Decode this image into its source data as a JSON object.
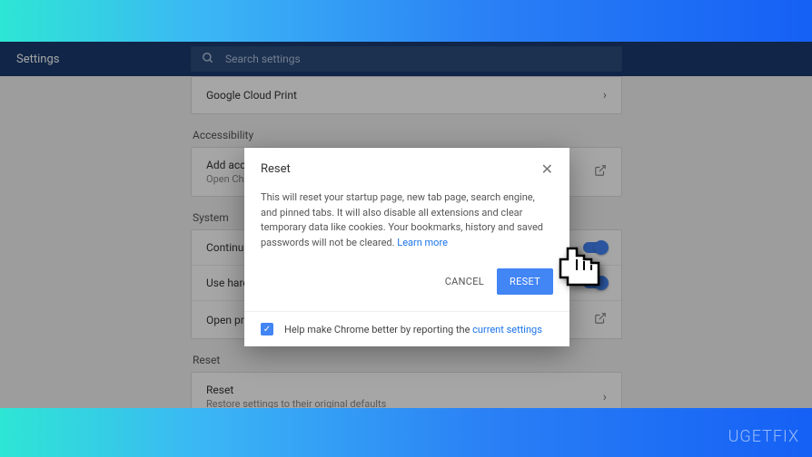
{
  "header": {
    "title": "Settings",
    "search_placeholder": "Search settings"
  },
  "sections": {
    "cloud_print": "Google Cloud Print",
    "accessibility_label": "Accessibility",
    "accessibility_title": "Add accessibility features",
    "accessibility_sub": "Open Chrome Web Store",
    "system_label": "System",
    "system_row1": "Continue running background apps when Chrome is closed",
    "system_row2": "Use hardware acceleration when available",
    "system_row3": "Open proxy settings",
    "reset_label": "Reset",
    "reset_title": "Reset",
    "reset_sub": "Restore settings to their original defaults"
  },
  "dialog": {
    "title": "Reset",
    "body_text": "This will reset your startup page, new tab page, search engine, and pinned tabs. It will also disable all extensions and clear temporary data like cookies. Your bookmarks, history and saved passwords will not be cleared. ",
    "learn_more": "Learn more",
    "cancel": "CANCEL",
    "reset": "RESET",
    "help_text": "Help make Chrome better by reporting the ",
    "help_link": "current settings"
  },
  "watermark": "UGETFIX"
}
